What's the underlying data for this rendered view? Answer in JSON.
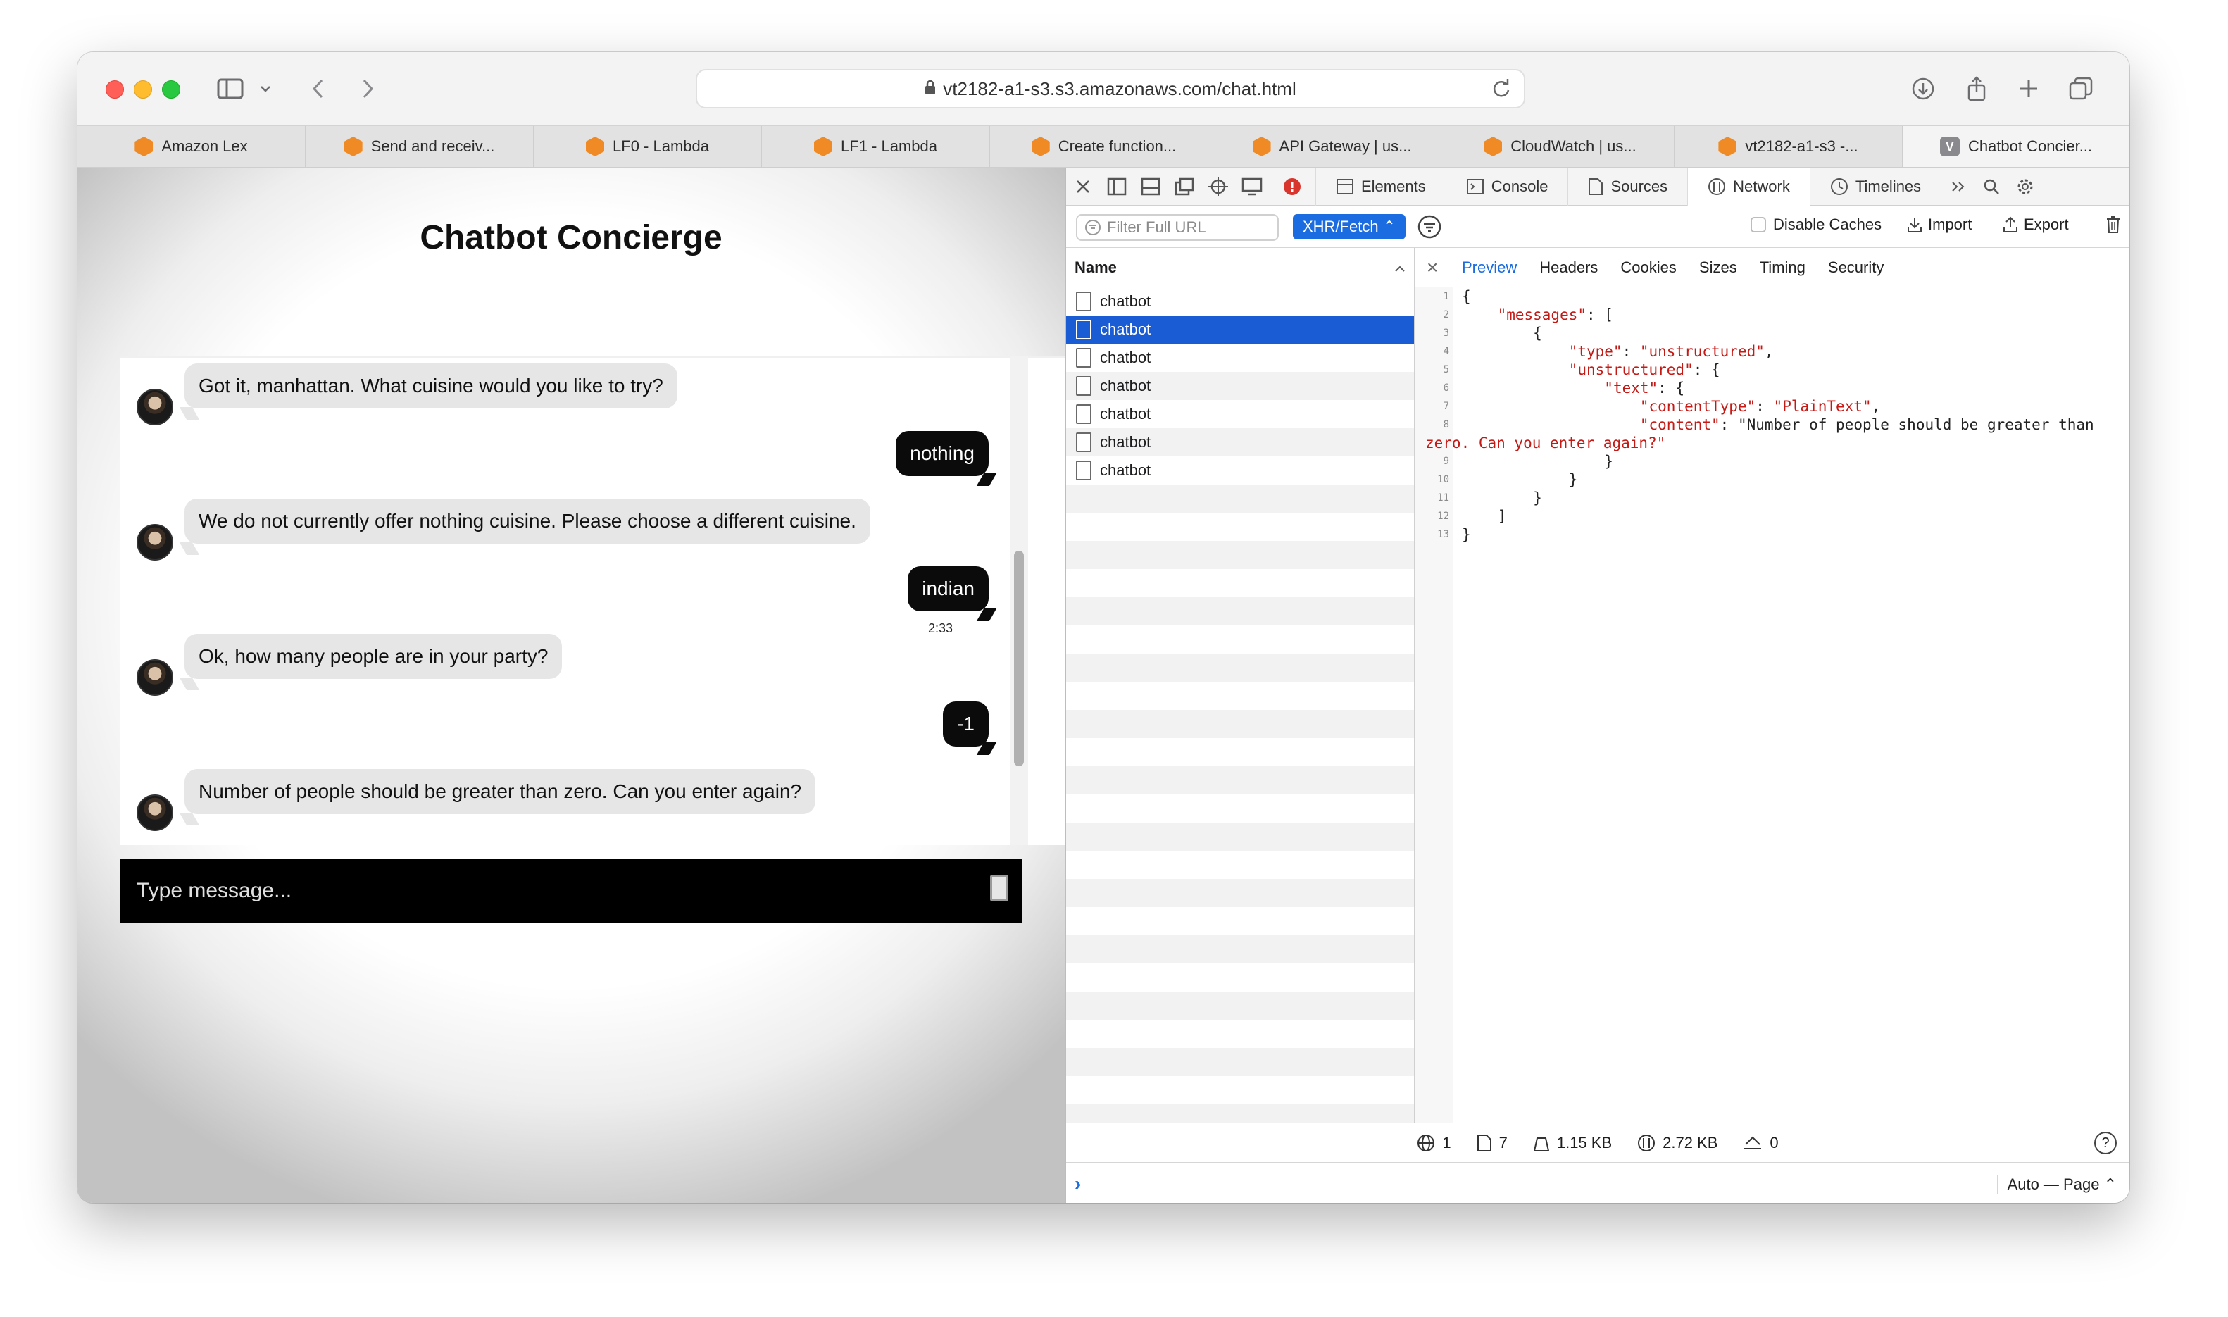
{
  "browser": {
    "url": "vt2182-a1-s3.s3.amazonaws.com/chat.html",
    "tabs": [
      {
        "label": "Amazon Lex",
        "icon": "aws-icon"
      },
      {
        "label": "Send and receiv...",
        "icon": "aws-icon"
      },
      {
        "label": "LF0 - Lambda",
        "icon": "aws-icon"
      },
      {
        "label": "LF1 - Lambda",
        "icon": "aws-icon"
      },
      {
        "label": "Create function...",
        "icon": "aws-icon"
      },
      {
        "label": "API Gateway | us...",
        "icon": "aws-icon"
      },
      {
        "label": "CloudWatch | us...",
        "icon": "aws-icon"
      },
      {
        "label": "vt2182-a1-s3 -...",
        "icon": "aws-icon"
      },
      {
        "label": "Chatbot Concier...",
        "icon": "v-favicon",
        "favicon_letter": "V",
        "active": true
      }
    ]
  },
  "chat": {
    "title": "Chatbot Concierge",
    "messages": [
      {
        "from": "bot",
        "text": "Got it, manhattan. What cuisine would you like to try?"
      },
      {
        "from": "user",
        "text": "nothing"
      },
      {
        "from": "bot",
        "text": "We do not currently offer nothing cuisine. Please choose a different cuisine."
      },
      {
        "from": "user",
        "text": "indian",
        "time": "2:33"
      },
      {
        "from": "bot",
        "text": "Ok, how many people are in your party?"
      },
      {
        "from": "user",
        "text": "-1"
      },
      {
        "from": "bot",
        "text": "Number of people should be greater than zero. Can you enter again?"
      }
    ],
    "input_placeholder": "Type message..."
  },
  "devtools": {
    "tabs": [
      "Elements",
      "Console",
      "Sources",
      "Network",
      "Timelines"
    ],
    "active_tab": "Network",
    "filter_placeholder": "Filter Full URL",
    "filter_type": "XHR/Fetch",
    "disable_caches": "Disable Caches",
    "import": "Import",
    "export": "Export",
    "name_header": "Name",
    "requests": [
      "chatbot",
      "chatbot",
      "chatbot",
      "chatbot",
      "chatbot",
      "chatbot",
      "chatbot"
    ],
    "selected_request_index": 1,
    "preview_tabs": [
      "Preview",
      "Headers",
      "Cookies",
      "Sizes",
      "Timing",
      "Security"
    ],
    "active_preview_tab": "Preview",
    "preview_lines": [
      "{",
      "    \"messages\": [",
      "        {",
      "            \"type\": \"unstructured\",",
      "            \"unstructured\": {",
      "                \"text\": {",
      "                    \"contentType\": \"PlainText\",",
      "                    \"content\": \"Number of people should be greater than",
      "zero. Can you enter again?\"",
      "                }",
      "            }",
      "        }",
      "    ]",
      "}"
    ],
    "line_numbers": [
      "1",
      "2",
      "3",
      "4",
      "5",
      "6",
      "7",
      "8",
      "",
      "9",
      "10",
      "11",
      "12",
      "13"
    ],
    "status": {
      "domains": "1",
      "resources": "7",
      "transferred": "1.15 KB",
      "size": "2.72 KB",
      "errors": "0"
    },
    "help": "?",
    "console_mode": "Auto — Page",
    "accent_color": "#1a6ce0"
  }
}
